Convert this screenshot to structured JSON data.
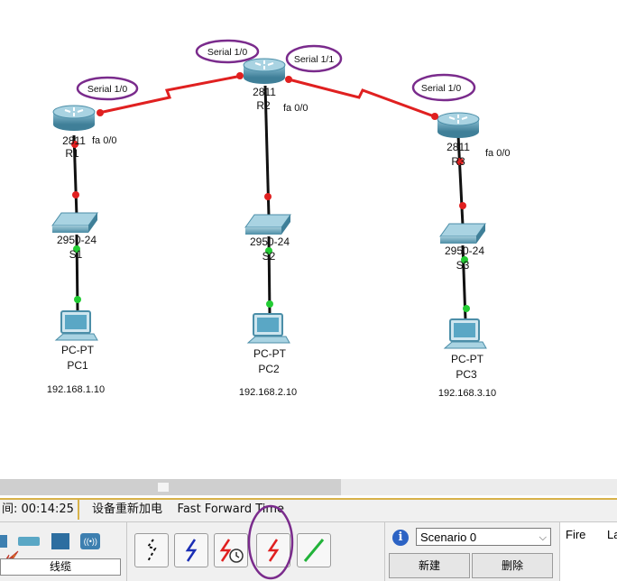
{
  "topology": {
    "routers": [
      {
        "model": "2811",
        "name": "R1",
        "interface_fa": "fa 0/0",
        "serial_label": "Serial 1/0"
      },
      {
        "model": "2811",
        "name": "R2",
        "interface_fa": "fa 0/0",
        "serial_left": "Serial 1/0",
        "serial_right": "Serial 1/1"
      },
      {
        "model": "2811",
        "name": "R3",
        "interface_fa": "fa 0/0",
        "serial_label": "Serial 1/0"
      }
    ],
    "switches": [
      {
        "model": "2950-24",
        "name": "S1"
      },
      {
        "model": "2950-24",
        "name": "S2"
      },
      {
        "model": "2950-24",
        "name": "S3"
      }
    ],
    "pcs": [
      {
        "model": "PC-PT",
        "name": "PC1",
        "ip": "192.168.1.10"
      },
      {
        "model": "PC-PT",
        "name": "PC2",
        "ip": "192.168.2.10"
      },
      {
        "model": "PC-PT",
        "name": "PC3",
        "ip": "192.168.3.10"
      }
    ],
    "colors": {
      "serial_link": "#e02020",
      "ethernet_link": "#111111",
      "port_down": "#e02020",
      "port_up": "#22cc33",
      "annotation_ring": "#7a2b8c"
    }
  },
  "statusbar": {
    "time": "间: 00:14:25",
    "power_cycle": "设备重新加电",
    "fast_forward": "Fast Forward Time"
  },
  "device_panel": {
    "category_label": "线缆",
    "icons": [
      "wireless-device-icon",
      "hub-icon",
      "switch-icon",
      "wireless-icon",
      "connections-icon"
    ]
  },
  "cable_tools": [
    "auto-connect-icon",
    "console-cable-icon",
    "serial-dce-icon",
    "serial-dte-icon",
    "crossover-cable-icon"
  ],
  "scenario": {
    "selected": "Scenario 0",
    "new_label": "新建",
    "delete_label": "删除"
  },
  "pdu_table": {
    "col_fire": "Fire",
    "col_last": "La"
  }
}
